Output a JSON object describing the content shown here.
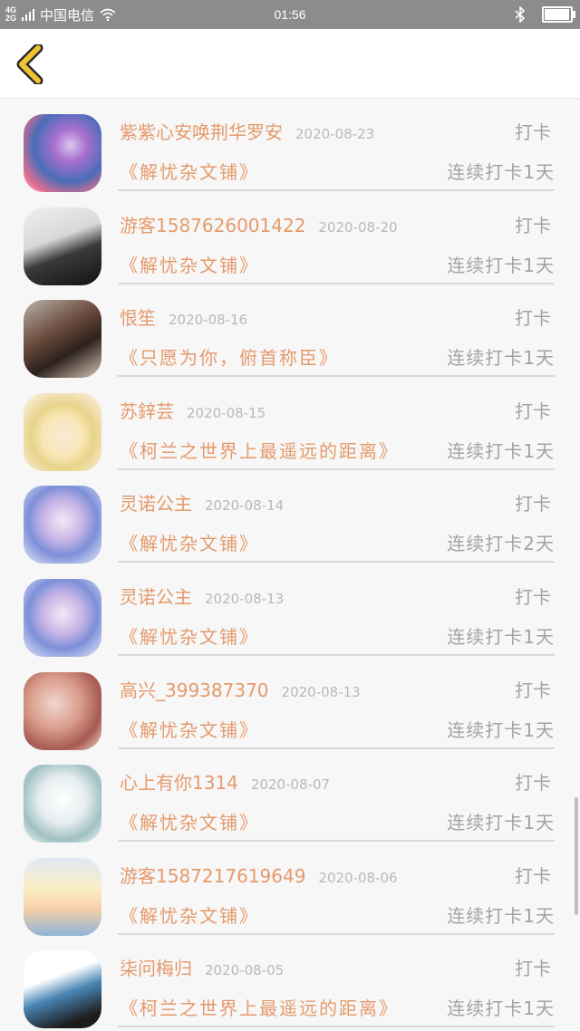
{
  "status_bar": {
    "net_top": "4G",
    "net_bottom": "2G",
    "carrier": "中国电信",
    "time": "01:56",
    "battery_level": 0.9
  },
  "header": {
    "back_icon": "chevron-left-icon",
    "accent": "#f1c232"
  },
  "colors": {
    "name": "#e59a6b",
    "secondary": "#a3a3a3"
  },
  "entries": [
    {
      "name": "紫紫心安唤荆华罗安",
      "date": "2020-08-23",
      "action": "打卡",
      "book": "《解忧杂文铺》",
      "streak": "连续打卡1天",
      "avatar": "avatar-fantasy-art"
    },
    {
      "name": "游客1587626001422",
      "date": "2020-08-20",
      "action": "打卡",
      "book": "《解忧杂文铺》",
      "streak": "连续打卡1天",
      "avatar": "avatar-selfie"
    },
    {
      "name": "恨笙",
      "date": "2020-08-16",
      "action": "打卡",
      "book": "《只愿为你，俯首称臣》",
      "streak": "连续打卡1天",
      "avatar": "avatar-girl-portrait"
    },
    {
      "name": "苏鋅芸",
      "date": "2020-08-15",
      "action": "打卡",
      "book": "《柯兰之世界上最遥远的距离》",
      "streak": "连续打卡1天",
      "avatar": "avatar-anime-blonde"
    },
    {
      "name": "灵诺公主",
      "date": "2020-08-14",
      "action": "打卡",
      "book": "《解忧杂文铺》",
      "streak": "连续打卡2天",
      "avatar": "avatar-anime-princess"
    },
    {
      "name": "灵诺公主",
      "date": "2020-08-13",
      "action": "打卡",
      "book": "《解忧杂文铺》",
      "streak": "连续打卡1天",
      "avatar": "avatar-anime-princess"
    },
    {
      "name": "高兴_399387370",
      "date": "2020-08-13",
      "action": "打卡",
      "book": "《解忧杂文铺》",
      "streak": "连续打卡1天",
      "avatar": "avatar-girl-flowers"
    },
    {
      "name": "心上有你1314",
      "date": "2020-08-07",
      "action": "打卡",
      "book": "《解忧杂文铺》",
      "streak": "连续打卡1天",
      "avatar": "avatar-anime-white"
    },
    {
      "name": "游客1587217619649",
      "date": "2020-08-06",
      "action": "打卡",
      "book": "《解忧杂文铺》",
      "streak": "连续打卡1天",
      "avatar": "avatar-anime-twins"
    },
    {
      "name": "柒问梅归",
      "date": "2020-08-05",
      "action": "打卡",
      "book": "《柯兰之世界上最遥远的距离》",
      "streak": "连续打卡1天",
      "avatar": "avatar-sketch-art"
    }
  ]
}
